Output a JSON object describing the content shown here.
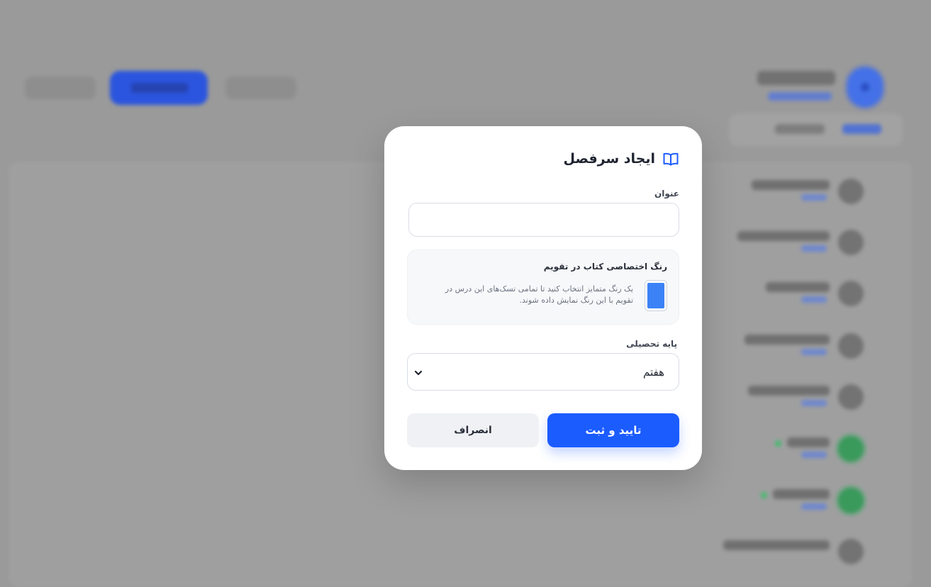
{
  "modal": {
    "title": "ایجاد سرفصل",
    "title_icon": "book-open-icon",
    "title_field": {
      "label": "عنوان",
      "value": "",
      "placeholder": ""
    },
    "calendar_color": {
      "heading": "رنگ اختصاصی کتاب در تقویم",
      "description": "یک رنگ متمایز انتخاب کنید تا تمامی تسک‌های این درس در تقویم با این رنگ نمایش داده شوند.",
      "value": "#3b82f6"
    },
    "grade_field": {
      "label": "پایه تحصیلی",
      "selected": "هفتم",
      "icon": "chevron-down-icon"
    },
    "submit_label": "تایید و ثبت",
    "cancel_label": "انصراف"
  },
  "colors": {
    "accent": "#1b5cff",
    "overlay": "#9a9a9a"
  }
}
